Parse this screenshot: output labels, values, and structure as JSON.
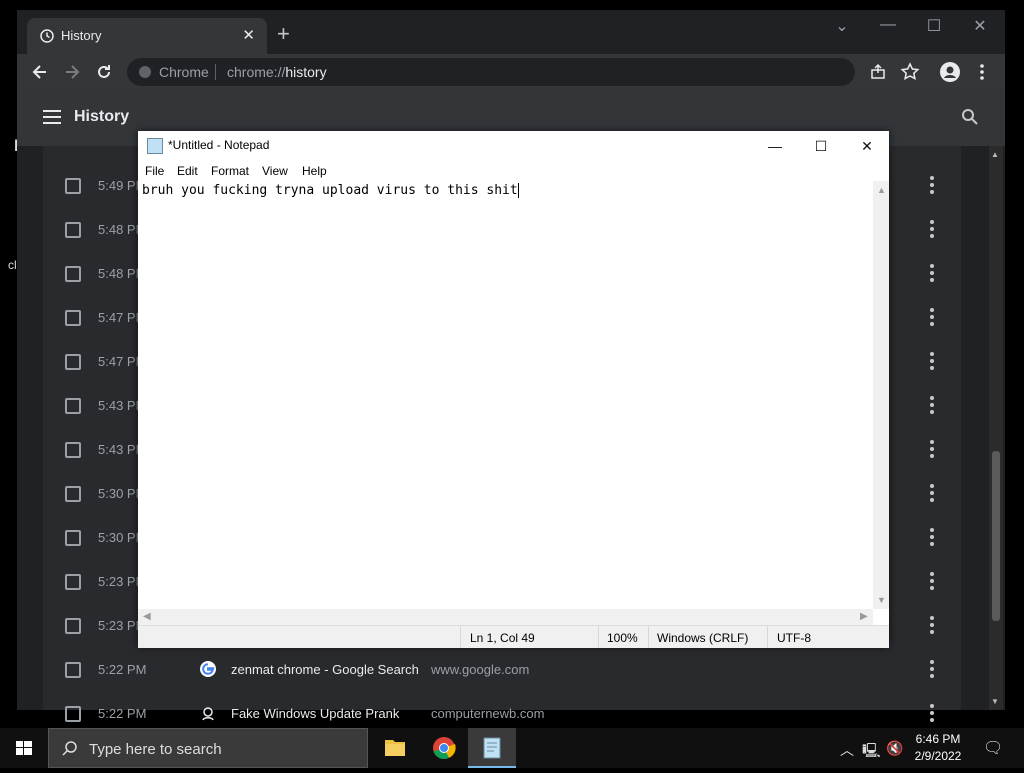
{
  "desktop": {
    "frag1": "l",
    "frag2": "cl"
  },
  "chrome": {
    "tab_title": "History",
    "tab_close": "✕",
    "new_tab": "+",
    "site_name": "Chrome",
    "url_prefix": "chrome://",
    "url_path": "history",
    "window_controls": {
      "minimize": "—",
      "maximize": "☐",
      "close": "✕",
      "tab_search": "⌄"
    }
  },
  "history_page": {
    "title": "History",
    "rows": [
      {
        "time": "5:49 PM",
        "title": "",
        "domain": ""
      },
      {
        "time": "5:48 PM",
        "title": "",
        "domain": ""
      },
      {
        "time": "5:48 PM",
        "title": "",
        "domain": ""
      },
      {
        "time": "5:47 PM",
        "title": "",
        "domain": ""
      },
      {
        "time": "5:47 PM",
        "title": "",
        "domain": ""
      },
      {
        "time": "5:43 PM",
        "title": "",
        "domain": ""
      },
      {
        "time": "5:43 PM",
        "title": "",
        "domain": ""
      },
      {
        "time": "5:30 PM",
        "title": "",
        "domain": ""
      },
      {
        "time": "5:30 PM",
        "title": "",
        "domain": ""
      },
      {
        "time": "5:23 PM",
        "title": "",
        "domain": ""
      },
      {
        "time": "5:23 PM",
        "title": "",
        "domain": ""
      },
      {
        "time": "5:22 PM",
        "title": "zenmat chrome - Google Search",
        "domain": "www.google.com"
      },
      {
        "time": "5:22 PM",
        "title": "Fake Windows Update Prank",
        "domain": "computernewb.com"
      }
    ]
  },
  "notepad": {
    "title": "*Untitled - Notepad",
    "menu": [
      "File",
      "Edit",
      "Format",
      "View",
      "Help"
    ],
    "content": "bruh you fucking tryna upload virus to this shit",
    "controls": {
      "minimize": "—",
      "maximize": "☐",
      "close": "✕"
    },
    "status": {
      "position": "Ln 1, Col 49",
      "zoom": "100%",
      "line_ending": "Windows (CRLF)",
      "encoding": "UTF-8"
    }
  },
  "taskbar": {
    "search_placeholder": "Type here to search",
    "time": "6:46 PM",
    "date": "2/9/2022",
    "apps": [
      "file-explorer",
      "chrome",
      "notepad"
    ]
  }
}
